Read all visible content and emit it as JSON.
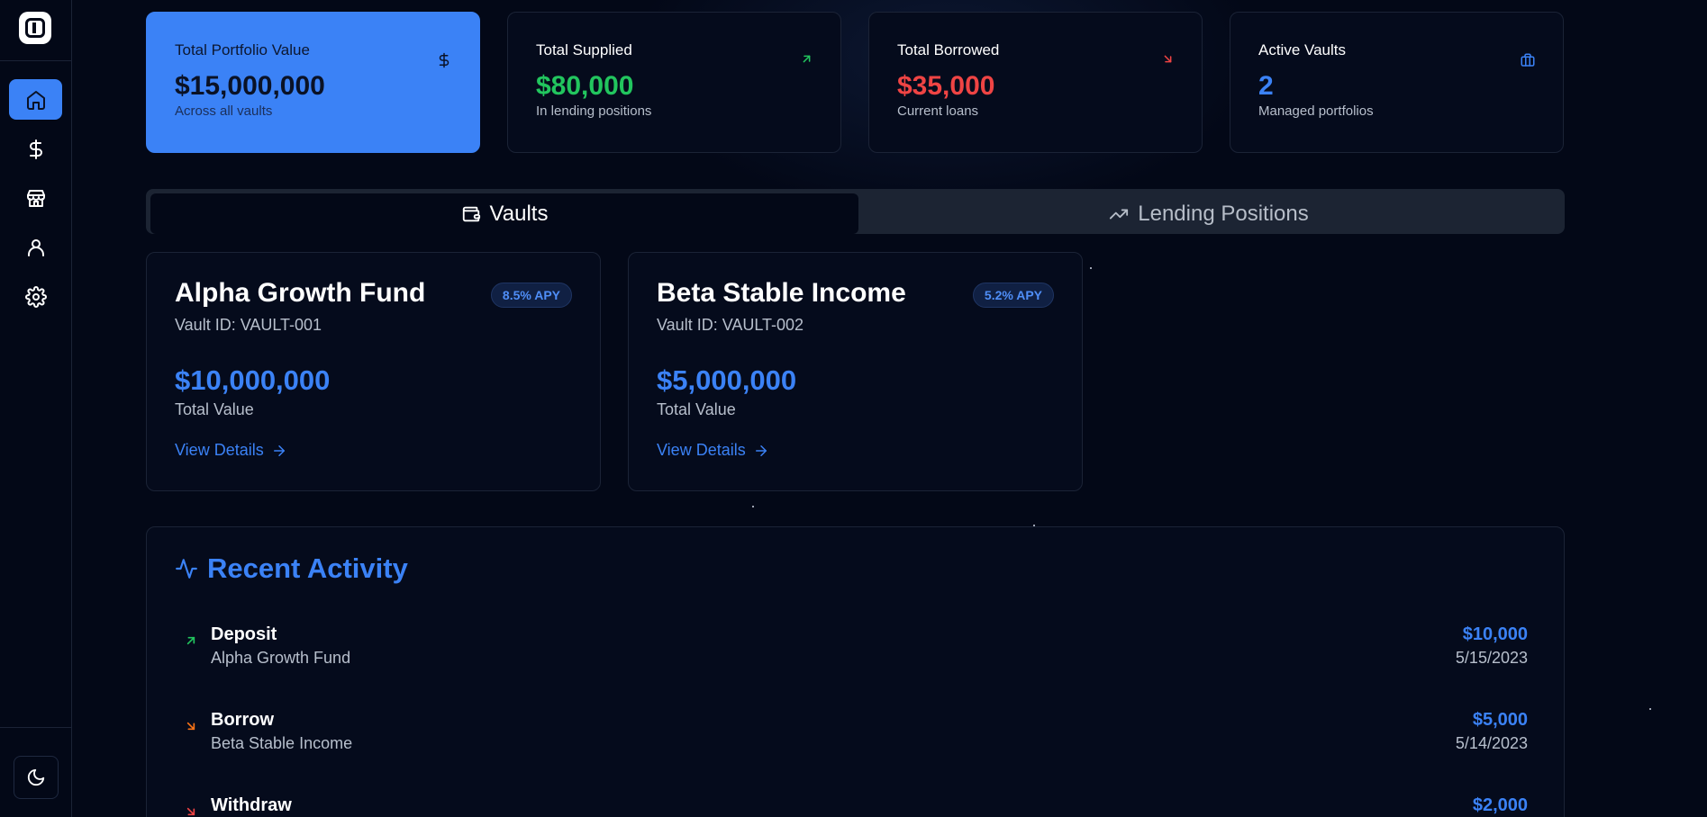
{
  "sidebar": {
    "items": [
      {
        "name": "home",
        "icon": "home-icon",
        "active": true
      },
      {
        "name": "dollar",
        "icon": "dollar-icon",
        "active": false
      },
      {
        "name": "store",
        "icon": "store-icon",
        "active": false
      },
      {
        "name": "user",
        "icon": "user-icon",
        "active": false
      },
      {
        "name": "settings",
        "icon": "gear-icon",
        "active": false
      }
    ],
    "theme_icon": "moon-icon"
  },
  "stats": [
    {
      "title": "Total Portfolio Value",
      "value": "$15,000,000",
      "sub": "Across all vaults",
      "icon": "dollar-icon",
      "color": "#0a1226"
    },
    {
      "title": "Total Supplied",
      "value": "$80,000",
      "sub": "In lending positions",
      "icon": "arrow-up-right-icon",
      "color": "#22c55e"
    },
    {
      "title": "Total Borrowed",
      "value": "$35,000",
      "sub": "Current loans",
      "icon": "arrow-down-right-icon",
      "color": "#ef4444"
    },
    {
      "title": "Active Vaults",
      "value": "2",
      "sub": "Managed portfolios",
      "icon": "briefcase-icon",
      "color": "#3b82f6"
    }
  ],
  "tabs": [
    {
      "label": "Vaults",
      "icon": "wallet-icon",
      "active": true
    },
    {
      "label": "Lending Positions",
      "icon": "trending-up-icon",
      "active": false
    }
  ],
  "vaults": [
    {
      "name": "Alpha Growth Fund",
      "apy": "8.5% APY",
      "id_text": "Vault ID: VAULT-001",
      "value": "$10,000,000",
      "value_label": "Total Value",
      "link": "View Details"
    },
    {
      "name": "Beta Stable Income",
      "apy": "5.2% APY",
      "id_text": "Vault ID: VAULT-002",
      "value": "$5,000,000",
      "value_label": "Total Value",
      "link": "View Details"
    }
  ],
  "activity": {
    "title": "Recent Activity",
    "icon": "activity-icon",
    "rows": [
      {
        "type": "Deposit",
        "vault": "Alpha Growth Fund",
        "amount": "$10,000",
        "date": "5/15/2023",
        "icon": "arrow-up-right-icon",
        "color": "#22c55e"
      },
      {
        "type": "Borrow",
        "vault": "Beta Stable Income",
        "amount": "$5,000",
        "date": "5/14/2023",
        "icon": "arrow-down-right-icon",
        "color": "#f97316"
      },
      {
        "type": "Withdraw",
        "vault": "",
        "amount": "$2,000",
        "date": "",
        "icon": "arrow-down-right-icon",
        "color": "#ef4444"
      }
    ]
  }
}
